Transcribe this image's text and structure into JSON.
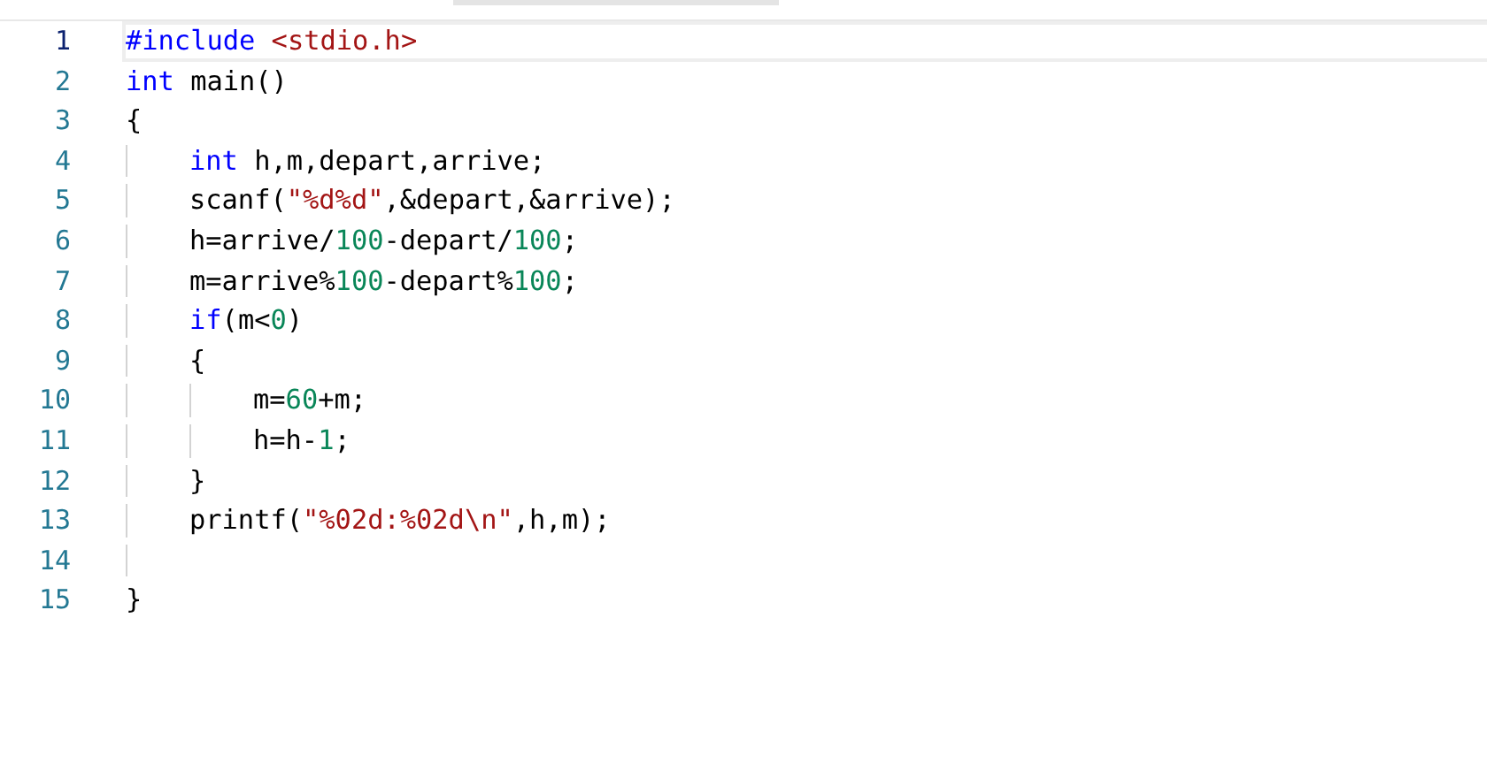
{
  "editor": {
    "lines": [
      {
        "number": "1",
        "current": true,
        "tokens": [
          {
            "kind": "keyword",
            "text": "#include "
          },
          {
            "kind": "string",
            "text": "<stdio.h>"
          }
        ]
      },
      {
        "number": "2",
        "current": false,
        "tokens": [
          {
            "kind": "keyword",
            "text": "int"
          },
          {
            "kind": "plain",
            "text": " main()"
          }
        ]
      },
      {
        "number": "3",
        "current": false,
        "tokens": [
          {
            "kind": "plain",
            "text": "{"
          }
        ]
      },
      {
        "number": "4",
        "current": false,
        "tokens": [
          {
            "kind": "keyword",
            "text": "    int"
          },
          {
            "kind": "plain",
            "text": " h,m,depart,arrive;"
          }
        ]
      },
      {
        "number": "5",
        "current": false,
        "tokens": [
          {
            "kind": "plain",
            "text": "    scanf("
          },
          {
            "kind": "string",
            "text": "\"%d%d\""
          },
          {
            "kind": "plain",
            "text": ",&depart,&arrive);"
          }
        ]
      },
      {
        "number": "6",
        "current": false,
        "tokens": [
          {
            "kind": "plain",
            "text": "    h=arrive/"
          },
          {
            "kind": "number",
            "text": "100"
          },
          {
            "kind": "plain",
            "text": "-depart/"
          },
          {
            "kind": "number",
            "text": "100"
          },
          {
            "kind": "plain",
            "text": ";"
          }
        ]
      },
      {
        "number": "7",
        "current": false,
        "tokens": [
          {
            "kind": "plain",
            "text": "    m=arrive%"
          },
          {
            "kind": "number",
            "text": "100"
          },
          {
            "kind": "plain",
            "text": "-depart%"
          },
          {
            "kind": "number",
            "text": "100"
          },
          {
            "kind": "plain",
            "text": ";"
          }
        ]
      },
      {
        "number": "8",
        "current": false,
        "tokens": [
          {
            "kind": "keyword",
            "text": "    if"
          },
          {
            "kind": "plain",
            "text": "(m<"
          },
          {
            "kind": "number",
            "text": "0"
          },
          {
            "kind": "plain",
            "text": ")"
          }
        ]
      },
      {
        "number": "9",
        "current": false,
        "tokens": [
          {
            "kind": "plain",
            "text": "    {"
          }
        ]
      },
      {
        "number": "10",
        "current": false,
        "tokens": [
          {
            "kind": "plain",
            "text": "        m="
          },
          {
            "kind": "number",
            "text": "60"
          },
          {
            "kind": "plain",
            "text": "+m;"
          }
        ]
      },
      {
        "number": "11",
        "current": false,
        "tokens": [
          {
            "kind": "plain",
            "text": "        h=h-"
          },
          {
            "kind": "number",
            "text": "1"
          },
          {
            "kind": "plain",
            "text": ";"
          }
        ]
      },
      {
        "number": "12",
        "current": false,
        "tokens": [
          {
            "kind": "plain",
            "text": "    }"
          }
        ]
      },
      {
        "number": "13",
        "current": false,
        "tokens": [
          {
            "kind": "plain",
            "text": "    printf("
          },
          {
            "kind": "string",
            "text": "\"%02d:%02d\\n\""
          },
          {
            "kind": "plain",
            "text": ",h,m);"
          }
        ]
      },
      {
        "number": "14",
        "current": false
      },
      {
        "number": "15",
        "current": false,
        "tokens": [
          {
            "kind": "plain",
            "text": "}"
          }
        ]
      }
    ]
  }
}
